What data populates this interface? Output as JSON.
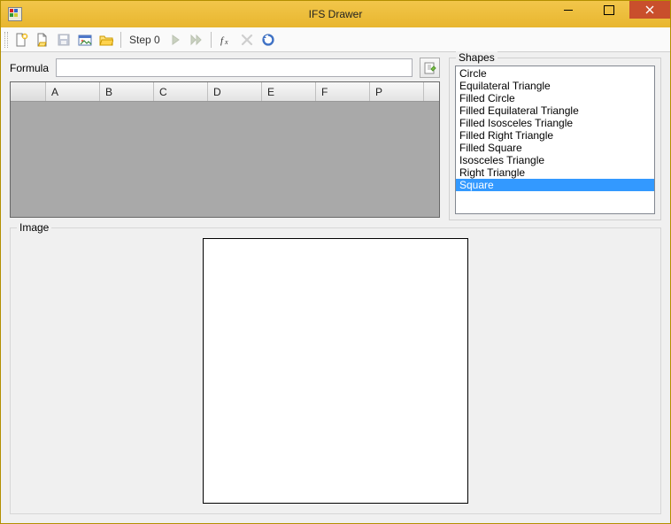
{
  "window": {
    "title": "IFS Drawer"
  },
  "toolbar": {
    "step_label": "Step 0"
  },
  "formula": {
    "label": "Formula",
    "value": ""
  },
  "grid": {
    "columns": [
      "A",
      "B",
      "C",
      "D",
      "E",
      "F",
      "P"
    ]
  },
  "shapes": {
    "label": "Shapes",
    "items": [
      "Circle",
      "Equilateral Triangle",
      "Filled Circle",
      "Filled Equilateral Triangle",
      "Filled Isosceles Triangle",
      "Filled Right Triangle",
      "Filled Square",
      "Isosceles Triangle",
      "Right Triangle",
      "Square"
    ],
    "selected_index": 9
  },
  "image": {
    "label": "Image"
  }
}
